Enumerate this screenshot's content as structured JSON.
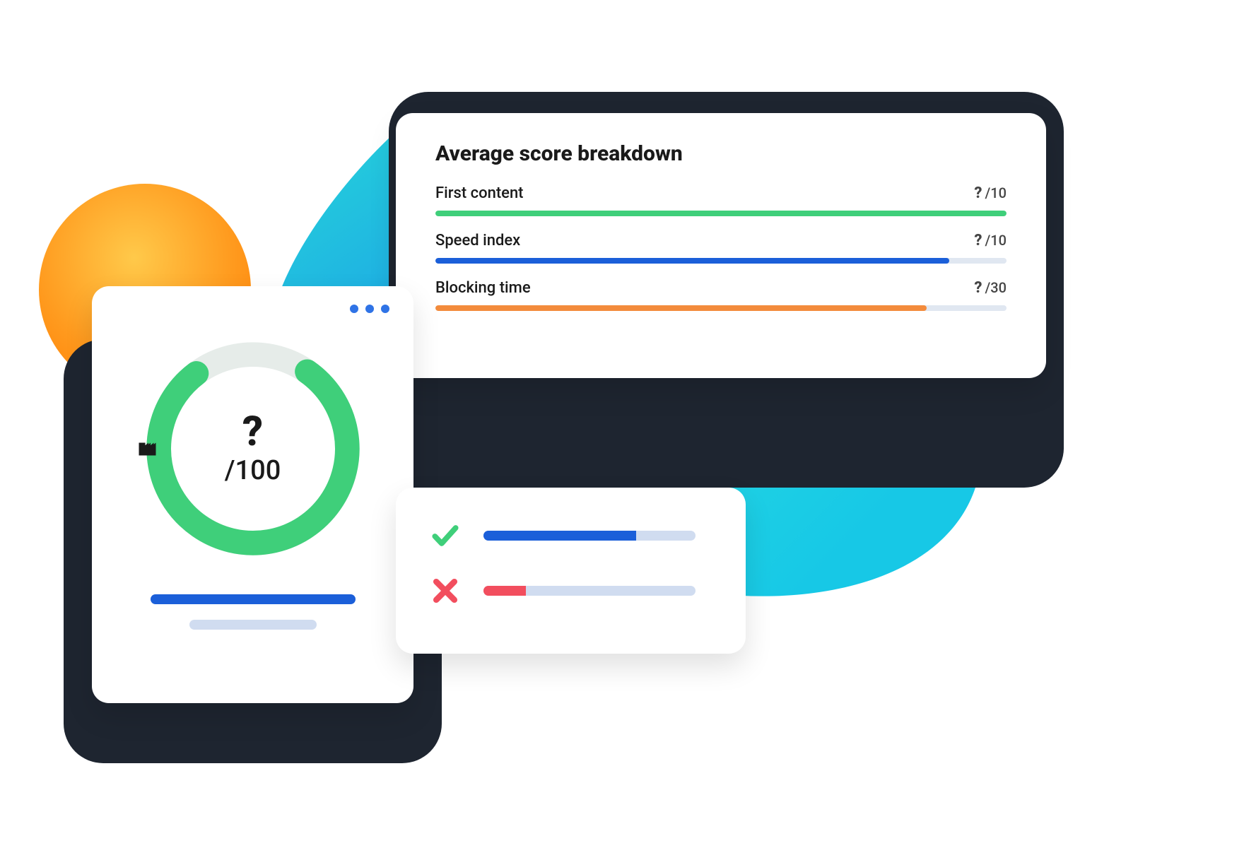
{
  "colors": {
    "green": "#3fcf7a",
    "blue": "#1b5fd9",
    "orange": "#f38b3c",
    "red": "#f24e5e",
    "track": "#e0e7f1"
  },
  "score_card": {
    "value_label": "?",
    "denominator_label": "/100",
    "gauge_percent": 80
  },
  "breakdown": {
    "title": "Average score breakdown",
    "rows": [
      {
        "label": "First content",
        "value_label": "?",
        "max_label": "/10",
        "fill_percent": 100,
        "color": "#3fcf7a"
      },
      {
        "label": "Speed index",
        "value_label": "?",
        "max_label": "/10",
        "fill_percent": 90,
        "color": "#1b5fd9"
      },
      {
        "label": "Blocking time",
        "value_label": "?",
        "max_label": "/30",
        "fill_percent": 86,
        "color": "#f38b3c"
      }
    ]
  },
  "checks": {
    "rows": [
      {
        "status": "pass",
        "fill_percent": 72,
        "color": "#1b5fd9"
      },
      {
        "status": "fail",
        "fill_percent": 20,
        "color": "#f24e5e"
      }
    ]
  }
}
